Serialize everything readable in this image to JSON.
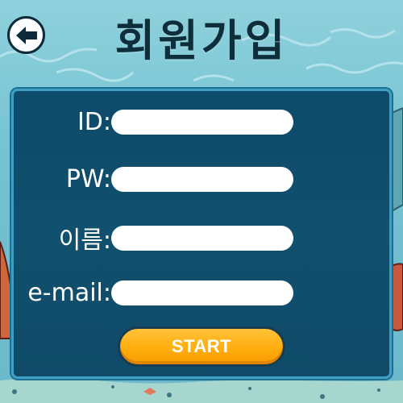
{
  "header": {
    "title": "회원가입",
    "back_icon": "arrow-left-icon"
  },
  "form": {
    "fields": [
      {
        "label": "ID:",
        "value": ""
      },
      {
        "label": "PW:",
        "value": ""
      },
      {
        "label": "이름:",
        "value": ""
      },
      {
        "label": "e-mail:",
        "value": ""
      }
    ],
    "submit_label": "START"
  },
  "colors": {
    "panel": "#0f4b68",
    "panel_border": "#3f9fc2",
    "button": "#ffae0e",
    "title": "#0f2e3c",
    "background": "#7fc9d6"
  }
}
